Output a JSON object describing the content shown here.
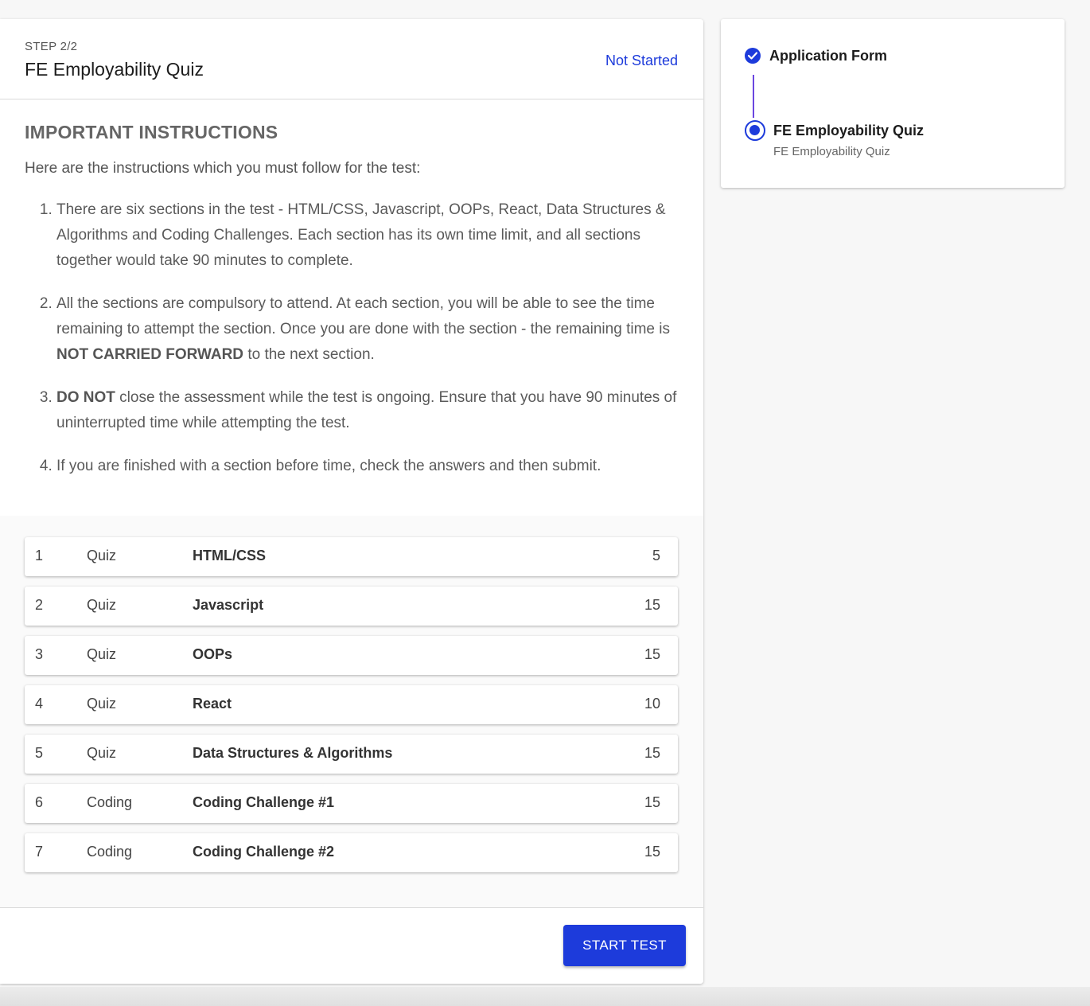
{
  "header": {
    "step_label": "STEP 2/2",
    "title": "FE Employability Quiz",
    "status": "Not Started",
    "status_color": "#1d3bdb"
  },
  "instructions": {
    "heading": "IMPORTANT INSTRUCTIONS",
    "intro": "Here are the instructions which you must follow for the test:",
    "items": [
      {
        "text": "There are six sections in the test - HTML/CSS, Javascript, OOPs, React, Data Structures & Algorithms and Coding Challenges. Each section has its own time limit, and all sections together would take 90 minutes to complete."
      },
      {
        "before": "All the sections are compulsory to attend. At each section, you will be able to see the time remaining to attempt the section. Once you are done with the section - the remaining time is ",
        "bold": "NOT CARRIED FORWARD",
        "after": " to the next section."
      },
      {
        "bold": "DO NOT",
        "after": " close the assessment while the test is ongoing. Ensure that you have 90 minutes of uninterrupted time while attempting the test."
      },
      {
        "text": "If you are finished with a section before time, check the answers and then submit."
      }
    ]
  },
  "sections": [
    {
      "num": "1",
      "type": "Quiz",
      "name": "HTML/CSS",
      "value": "5"
    },
    {
      "num": "2",
      "type": "Quiz",
      "name": "Javascript",
      "value": "15"
    },
    {
      "num": "3",
      "type": "Quiz",
      "name": "OOPs",
      "value": "15"
    },
    {
      "num": "4",
      "type": "Quiz",
      "name": "React",
      "value": "10"
    },
    {
      "num": "5",
      "type": "Quiz",
      "name": "Data Structures & Algorithms",
      "value": "15"
    },
    {
      "num": "6",
      "type": "Coding",
      "name": "Coding Challenge #1",
      "value": "15"
    },
    {
      "num": "7",
      "type": "Coding",
      "name": "Coding Challenge #2",
      "value": "15"
    }
  ],
  "footer": {
    "start_label": "START TEST",
    "accent": "#1d3bdb"
  },
  "stepper": {
    "steps": [
      {
        "label": "Application Form",
        "state": "completed",
        "icon": "check-circle-icon"
      },
      {
        "label": "FE Employability Quiz",
        "sublabel": "FE Employability Quiz",
        "state": "active",
        "icon": "radio-active-icon"
      }
    ]
  }
}
